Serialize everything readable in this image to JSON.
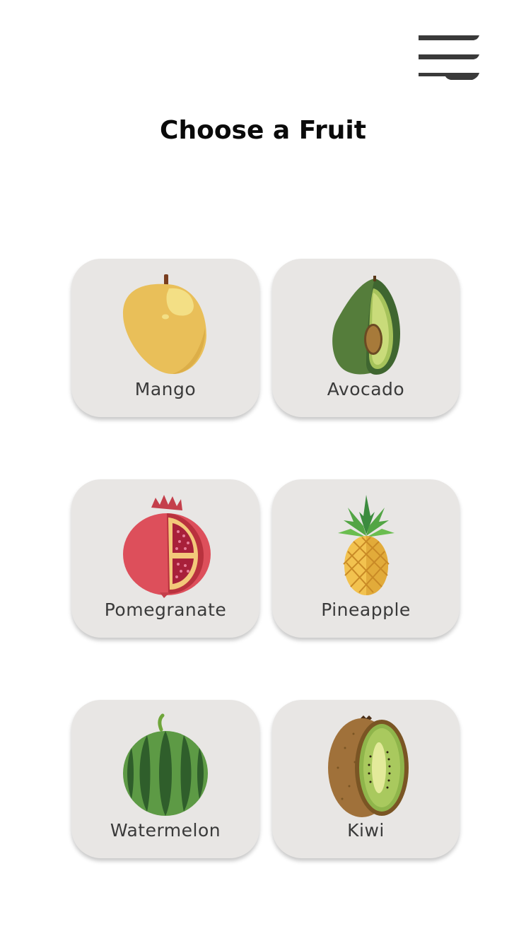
{
  "header": {
    "title": "Choose a Fruit",
    "menu_icon": "hamburger-menu-icon"
  },
  "fruits": [
    {
      "label": "Mango",
      "icon": "mango-icon"
    },
    {
      "label": "Avocado",
      "icon": "avocado-icon"
    },
    {
      "label": "Pomegranate",
      "icon": "pomegranate-icon"
    },
    {
      "label": "Pineapple",
      "icon": "pineapple-icon"
    },
    {
      "label": "Watermelon",
      "icon": "watermelon-icon"
    },
    {
      "label": "Kiwi",
      "icon": "kiwi-icon"
    }
  ],
  "colors": {
    "card_background": "#e8e6e4",
    "menu_icon": "#3a3a3a",
    "title_text": "#0a0a0a",
    "label_text": "#3a3a3a"
  }
}
